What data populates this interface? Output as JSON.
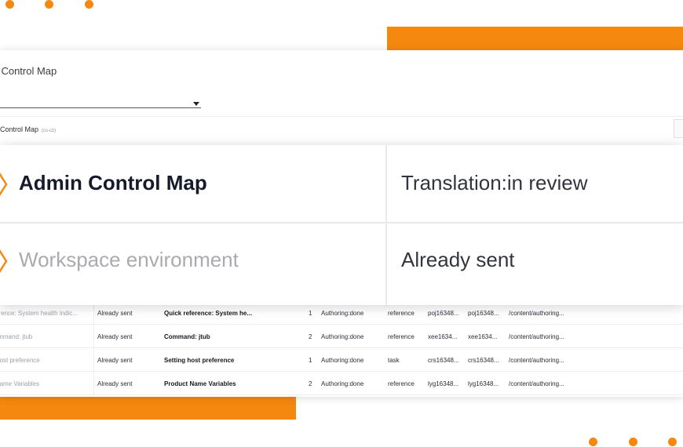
{
  "colors": {
    "accent": "#f5890f"
  },
  "window": {
    "title": "Admin Control Map",
    "breadcrumb": {
      "label": "Admin Control Map",
      "locale": "(cs-cz)"
    }
  },
  "card": {
    "name": "Admin Control Map",
    "environment": "Workspace environment",
    "translation_status": "Translation:in review",
    "sent_status": "Already sent",
    "icons": [
      "chevron-right-icon",
      "chevron-right-icon"
    ]
  },
  "table": {
    "rows": [
      {
        "source": "Quick reference: System health indic...",
        "status": "Already sent",
        "title": "Quick reference: System he...",
        "num": "1",
        "state": "Authoring:done",
        "type": "reference",
        "id1": "poj16348...",
        "id2": "poj16348...",
        "path": "/content/authoring..."
      },
      {
        "source": "Command: jtub",
        "status": "Already sent",
        "title": "Command: jtub",
        "num": "2",
        "state": "Authoring:done",
        "type": "reference",
        "id1": "xee1634...",
        "id2": "xee1634...",
        "path": "/content/authoring..."
      },
      {
        "source": "Setting host preference",
        "status": "Already sent",
        "title": "Setting host preference",
        "num": "1",
        "state": "Authoring:done",
        "type": "task",
        "id1": "crs16348...",
        "id2": "crs16348...",
        "path": "/content/authoring..."
      },
      {
        "source": "Product Name Variables",
        "status": "Already sent",
        "title": "Product Name Variables",
        "num": "2",
        "state": "Authoring:done",
        "type": "reference",
        "id1": "lyg16348...",
        "id2": "lyg16348...",
        "path": "/content/authoring..."
      }
    ]
  }
}
